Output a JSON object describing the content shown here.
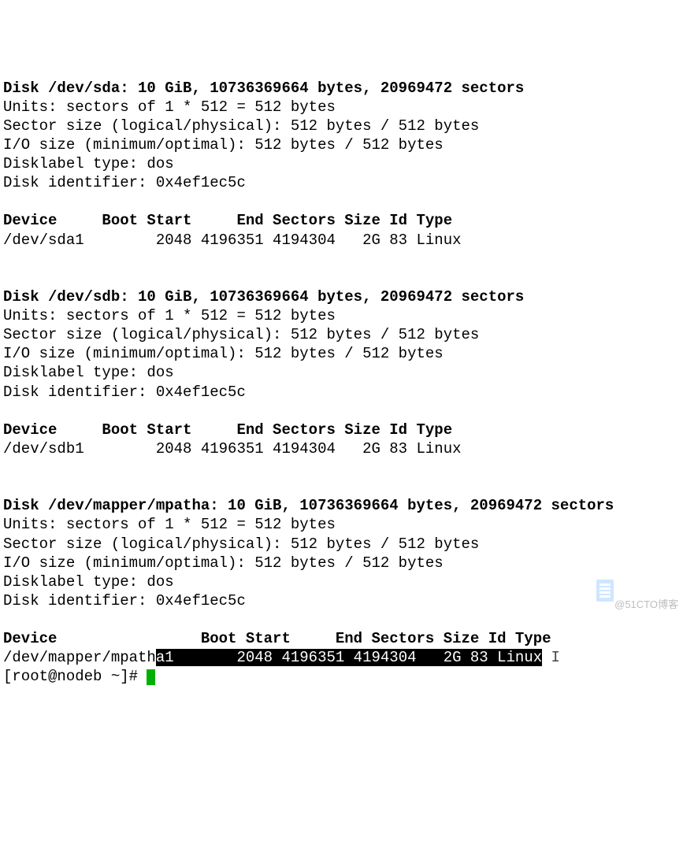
{
  "disks": [
    {
      "header": "Disk /dev/sda: 10 GiB, 10736369664 bytes, 20969472 sectors",
      "units": "Units: sectors of 1 * 512 = 512 bytes",
      "sector_size": "Sector size (logical/physical): 512 bytes / 512 bytes",
      "io_size": "I/O size (minimum/optimal): 512 bytes / 512 bytes",
      "label_type": "Disklabel type: dos",
      "identifier": "Disk identifier: 0x4ef1ec5c",
      "table_header": "Device     Boot Start     End Sectors Size Id Type",
      "table_row": "/dev/sda1        2048 4196351 4194304   2G 83 Linux"
    },
    {
      "header": "Disk /dev/sdb: 10 GiB, 10736369664 bytes, 20969472 sectors",
      "units": "Units: sectors of 1 * 512 = 512 bytes",
      "sector_size": "Sector size (logical/physical): 512 bytes / 512 bytes",
      "io_size": "I/O size (minimum/optimal): 512 bytes / 512 bytes",
      "label_type": "Disklabel type: dos",
      "identifier": "Disk identifier: 0x4ef1ec5c",
      "table_header": "Device     Boot Start     End Sectors Size Id Type",
      "table_row": "/dev/sdb1        2048 4196351 4194304   2G 83 Linux"
    },
    {
      "header": "Disk /dev/mapper/mpatha: 10 GiB, 10736369664 bytes, 20969472 sectors",
      "units": "Units: sectors of 1 * 512 = 512 bytes",
      "sector_size": "Sector size (logical/physical): 512 bytes / 512 bytes",
      "io_size": "I/O size (minimum/optimal): 512 bytes / 512 bytes",
      "label_type": "Disklabel type: dos",
      "identifier": "Disk identifier: 0x4ef1ec5c",
      "table_header": "Device                Boot Start     End Sectors Size Id Type",
      "table_row_pre": "/dev/mapper/mpath",
      "table_row_hl": "a1       2048 4196351 4194304   2G 83 Linux"
    }
  ],
  "prompt": "[root@nodeb ~]# ",
  "text_cursor": " I",
  "watermark": "@51CTO博客"
}
